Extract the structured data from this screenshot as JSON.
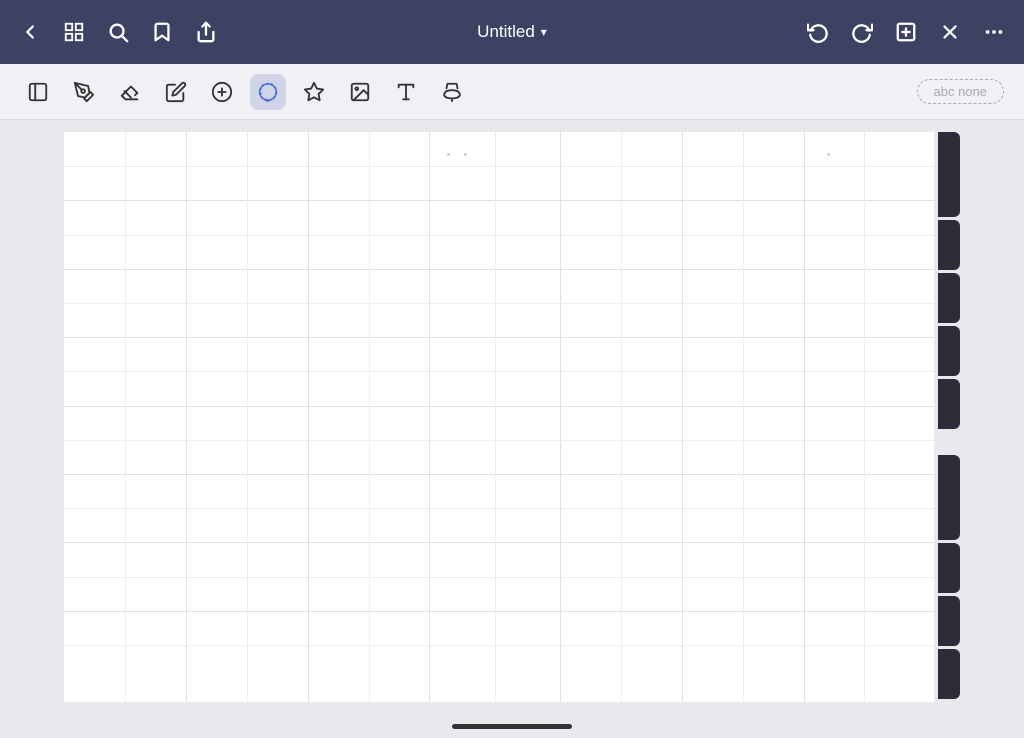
{
  "topbar": {
    "title": "Untitled",
    "chevron": "▾",
    "back_icon": "chevron-left",
    "grid_icon": "grid",
    "search_icon": "search",
    "bookmark_icon": "bookmark",
    "share_icon": "share",
    "undo_icon": "undo",
    "redo_icon": "redo",
    "add_page_icon": "add-page",
    "close_icon": "close",
    "more_icon": "more"
  },
  "toolbar": {
    "tools": [
      {
        "name": "sidebar-toggle",
        "icon": "sidebar"
      },
      {
        "name": "pen",
        "icon": "pen"
      },
      {
        "name": "eraser",
        "icon": "eraser"
      },
      {
        "name": "highlighter",
        "icon": "highlighter"
      },
      {
        "name": "fill",
        "icon": "fill"
      },
      {
        "name": "lasso",
        "icon": "lasso",
        "active": true
      },
      {
        "name": "shape",
        "icon": "shape"
      },
      {
        "name": "image",
        "icon": "image"
      },
      {
        "name": "text",
        "icon": "text"
      },
      {
        "name": "marker",
        "icon": "marker"
      }
    ],
    "text_style_label": "abc none"
  },
  "canvas": {
    "background": "white",
    "grid_lines": true
  },
  "tabs": [
    {
      "height": "tall"
    },
    {
      "height": "medium"
    },
    {
      "height": "medium"
    },
    {
      "height": "medium"
    },
    {
      "height": "medium"
    },
    {
      "height": "tall"
    },
    {
      "height": "medium"
    },
    {
      "height": "medium"
    },
    {
      "height": "medium"
    }
  ]
}
